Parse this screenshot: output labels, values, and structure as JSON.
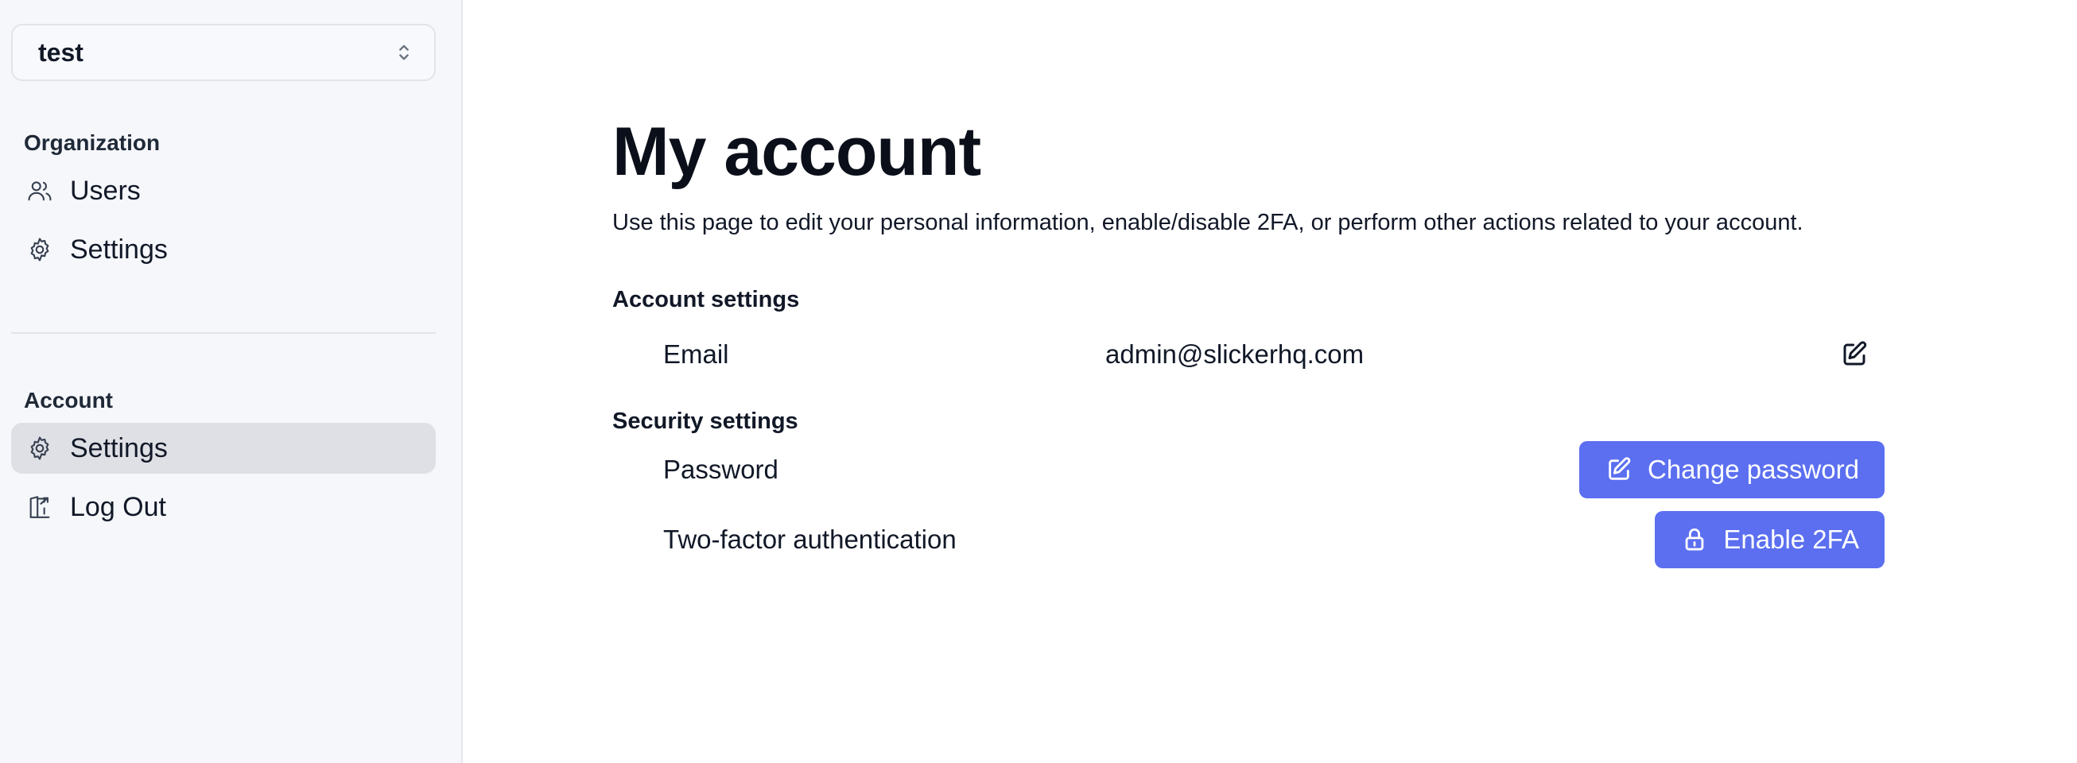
{
  "org_selector": {
    "name": "test",
    "icon": "chevron-up-down-icon"
  },
  "sidebar": {
    "organization_label": "Organization",
    "organization_items": [
      {
        "label": "Users",
        "icon": "users-icon"
      },
      {
        "label": "Settings",
        "icon": "gear-icon"
      }
    ],
    "account_label": "Account",
    "account_items": [
      {
        "label": "Settings",
        "icon": "gear-icon",
        "active": true
      },
      {
        "label": "Log Out",
        "icon": "logout-icon"
      }
    ]
  },
  "main": {
    "title": "My account",
    "description": "Use this page to edit your personal information, enable/disable 2FA, or perform other actions related to your account.",
    "account_settings": {
      "heading": "Account settings",
      "email_label": "Email",
      "email_value": "admin@slickerhq.com",
      "edit_icon": "pencil-square-icon"
    },
    "security_settings": {
      "heading": "Security settings",
      "password_label": "Password",
      "change_password_button": "Change password",
      "tfa_label": "Two-factor authentication",
      "enable_2fa_button": "Enable 2FA"
    }
  },
  "colors": {
    "primary": "#5b6ff0",
    "sidebar_bg": "#f6f7fb",
    "active_item_bg": "#dfe0e5"
  }
}
